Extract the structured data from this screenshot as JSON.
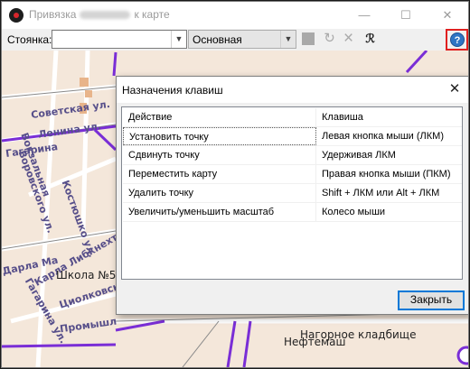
{
  "window": {
    "title_before": "Привязка",
    "title_after": "к карте",
    "min_glyph": "—",
    "max_glyph": "☐",
    "close_glyph": "✕"
  },
  "toolbar": {
    "stop_label": "Стоянка:",
    "stop_value": "",
    "layer_value": "Основная",
    "dropdown_glyph": "▼",
    "icons": [
      "stop-icon",
      "redo-icon",
      "delete-icon",
      "pick-point-icon",
      "help-icon"
    ],
    "help_glyph": "?"
  },
  "map": {
    "labels": [
      "Советская ул.",
      "Ленина ул.",
      "Гагарина",
      "Воровского ул.",
      "Вокзальная",
      "Костюшко ул.",
      "Карла Либкнехта ул.",
      "Дарла Ма",
      "Школа №5",
      "Циолковско",
      "Промышл",
      "Гагарина ул.",
      "Нагорное кладбище",
      "Нефтемаш"
    ]
  },
  "dialog": {
    "title": "Назначения клавиш",
    "close_glyph": "✕",
    "columns": [
      "Действие",
      "Клавиша"
    ],
    "rows": [
      [
        "Установить точку",
        "Левая кнопка мыши (ЛКМ)"
      ],
      [
        "Сдвинуть точку",
        "Удерживая ЛКМ"
      ],
      [
        "Переместить карту",
        "Правая кнопка мыши (ПКМ)"
      ],
      [
        "Удалить точку",
        "Shift + ЛКМ или Alt + ЛКМ"
      ],
      [
        "Увеличить/уменьшить масштаб",
        "Колесо мыши"
      ]
    ],
    "selected_row": 0,
    "close_button": "Закрыть"
  },
  "colors": {
    "accent": "#0078d7",
    "help_highlight": "#e02020",
    "route": "#7a2ed6",
    "map_background": "#f4e7da"
  }
}
